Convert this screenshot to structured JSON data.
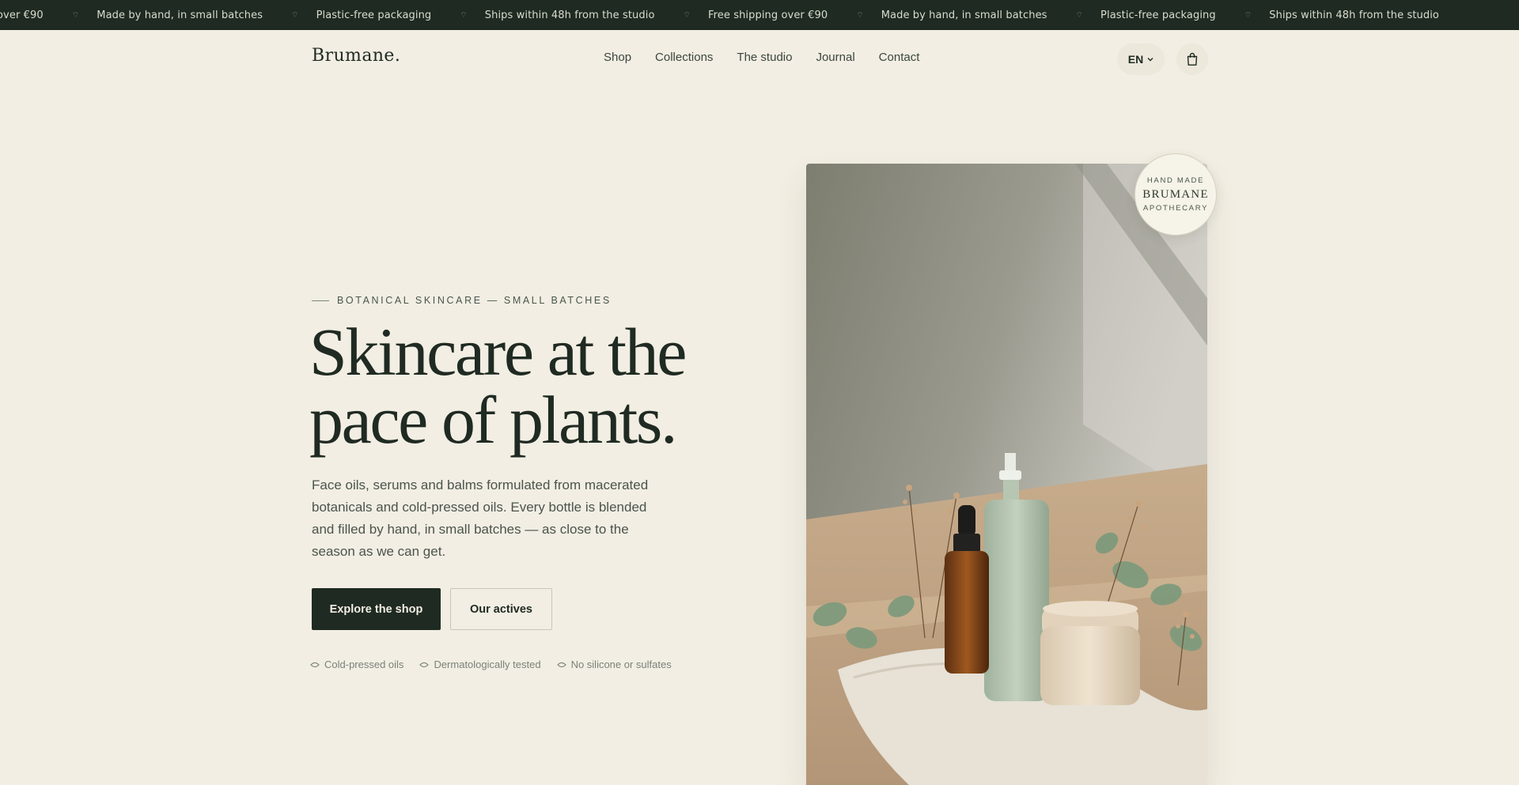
{
  "announcement": {
    "items": [
      "over €90",
      "Made by hand, in small batches",
      "Plastic-free packaging",
      "Ships within 48h from the studio",
      "Free shipping over €90",
      "Made by hand, in small batches",
      "Plastic-free packaging",
      "Ships within 48h from the studio"
    ],
    "separator": "⌔"
  },
  "header": {
    "logo": "Brumane.",
    "nav": [
      "Shop",
      "Collections",
      "The studio",
      "Journal",
      "Contact"
    ],
    "language": "EN"
  },
  "hero": {
    "eyebrow": "BOTANICAL SKINCARE — SMALL BATCHES",
    "headline_line1": "Skincare at the",
    "headline_line2": "pace of plants.",
    "lede": "Face oils, serums and balms formulated from macerated botanicals and cold-pressed oils. Every bottle is blended and filled by hand, in small batches — as close to the season as we can get.",
    "primary_cta": "Explore the shop",
    "secondary_cta": "Our actives",
    "badges": [
      "Cold-pressed oils",
      "Dermatologically tested",
      "No silicone or sulfates"
    ],
    "stamp": {
      "line1": "HAND MADE",
      "line2": "BRUMANE",
      "line3": "APOTHECARY"
    }
  },
  "colors": {
    "background": "#f2eee3",
    "ink": "#1f2a22",
    "muted": "#4b544c"
  }
}
